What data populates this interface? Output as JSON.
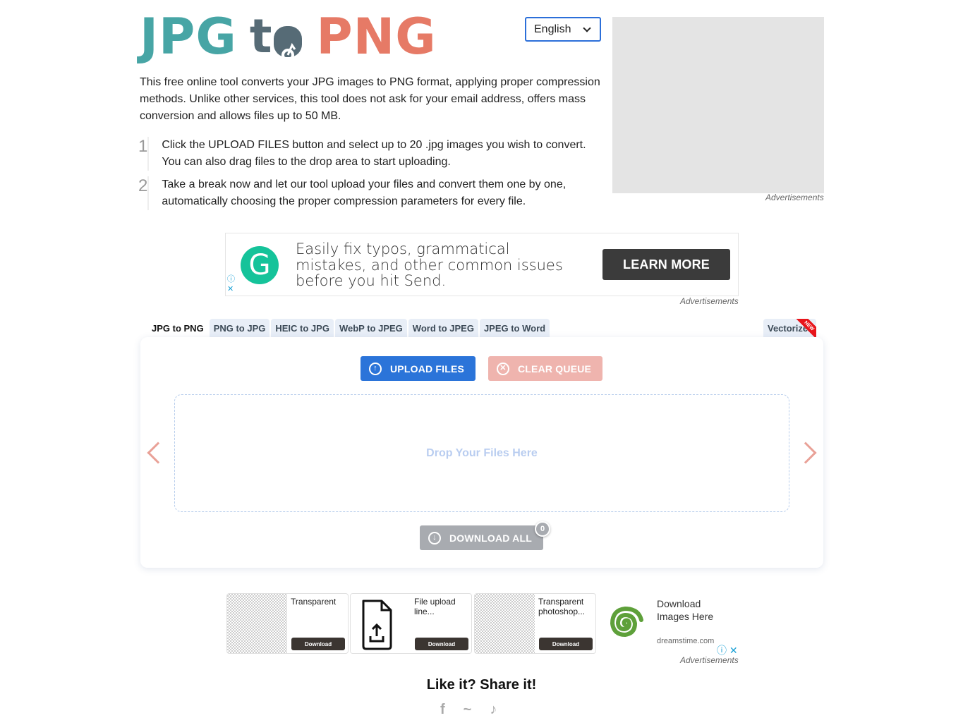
{
  "header": {
    "logo": {
      "part1": "JPG",
      "part2_t": "t",
      "part3": "PNG"
    },
    "language": "English"
  },
  "intro": "This free online tool converts your JPG images to PNG format, applying proper compression methods. Unlike other services, this tool does not ask for your email address, offers mass conversion and allows files up to 50 MB.",
  "steps": [
    {
      "num": "1",
      "text": "Click the UPLOAD FILES button and select up to 20 .jpg images you wish to convert. You can also drag files to the drop area to start uploading."
    },
    {
      "num": "2",
      "text": "Take a break now and let our tool upload your files and convert them one by one, automatically choosing the proper compression parameters for every file."
    }
  ],
  "ads": {
    "label": "Advertisements",
    "banner": {
      "logo_letter": "G",
      "text": "Easily fix typos, grammatical mistakes, and other common issues before you hit Send.",
      "cta": "LEARN MORE",
      "info_icon": "ⓘ",
      "close_icon": "✕"
    },
    "cards": [
      {
        "title": "Transparent",
        "button": "Download"
      },
      {
        "title": "File upload line...",
        "button": "Download"
      },
      {
        "title": "Transparent photoshop...",
        "button": "Download"
      }
    ],
    "dreamstime": {
      "title": "Download Images Here",
      "url": "dreamstime.com",
      "controls": "ⓘ ✕"
    }
  },
  "tabs": [
    {
      "label": "JPG to PNG",
      "active": true
    },
    {
      "label": "PNG to JPG"
    },
    {
      "label": "HEIC to JPG"
    },
    {
      "label": "WebP to JPEG"
    },
    {
      "label": "Word to JPEG"
    },
    {
      "label": "JPEG to Word"
    }
  ],
  "tab_vectorizer": {
    "label": "Vectorizer!",
    "ribbon": "NEW"
  },
  "tool": {
    "upload_label": "UPLOAD FILES",
    "clear_label": "CLEAR QUEUE",
    "dropzone_text": "Drop Your Files Here",
    "download_all_label": "DOWNLOAD ALL",
    "download_count": "0",
    "icons": {
      "upload": "↑",
      "clear": "✕",
      "download": "↓"
    }
  },
  "share": {
    "title": "Like it? Share it!"
  }
}
